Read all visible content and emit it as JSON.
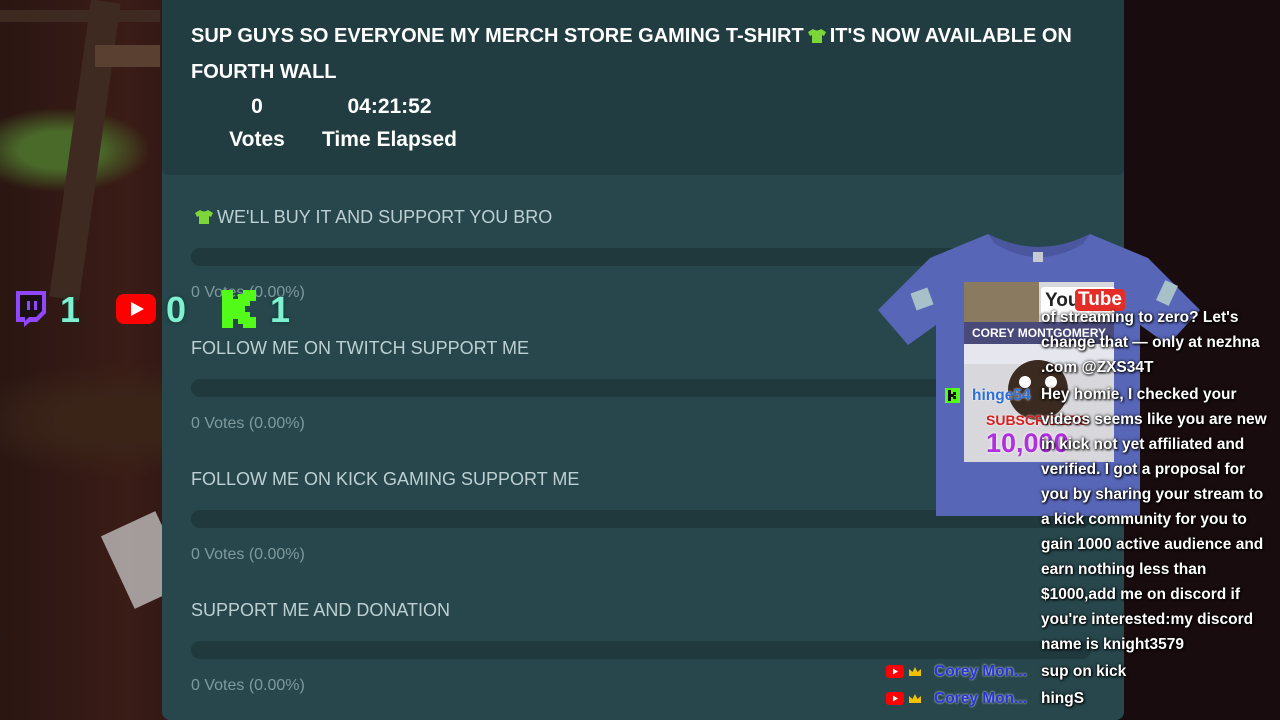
{
  "poll": {
    "title_part1": "SUP GUYS SO EVERYONE MY MERCH STORE GAMING T-SHIRT",
    "title_part2": "IT'S NOW AVAILABLE ON FOURTH WALL",
    "votes_value": "0",
    "votes_label": "Votes",
    "time_value": "04:21:52",
    "time_label": "Time Elapsed",
    "options": [
      {
        "label": "WE'LL BUY IT AND SUPPORT YOU BRO",
        "votes": "0 Votes (0.00%)",
        "fraction": 0
      },
      {
        "label": "FOLLOW ME ON TWITCH SUPPORT ME",
        "votes": "0 Votes (0.00%)",
        "fraction": 0
      },
      {
        "label": "FOLLOW ME ON KICK GAMING SUPPORT ME",
        "votes": "0 Votes (0.00%)",
        "fraction": 0
      },
      {
        "label": "SUPPORT ME AND DONATION",
        "votes": "0 Votes (0.00%)",
        "fraction": 0
      }
    ],
    "colors": {
      "panel": "#27474c",
      "header": "#213d42",
      "shirt_emoji": "#7cd63a"
    }
  },
  "counters": [
    {
      "icon": "twitch-icon",
      "value": "1",
      "color": "#9146ff"
    },
    {
      "icon": "youtube-icon",
      "value": "0",
      "color": "#ff0000"
    },
    {
      "icon": "kick-icon",
      "value": "1",
      "color": "#53fc18"
    }
  ],
  "merch": {
    "youtube_logo_you": "You",
    "youtube_logo_tube": "Tube",
    "banner_text": "COREY MONTGOMERY",
    "subscriber_label": "SUBSCRIBERS",
    "subscriber_count": "10,000"
  },
  "chat": {
    "message_lines": [
      "of streaming to zero? Let's",
      "change that — only at nezhna",
      ".com @ZXS34T",
      "Hey homie, I checked your",
      "videos seems like you are new",
      "in kick not yet affiliated and",
      "verified. I got a proposal for",
      "you by sharing your stream to",
      "a kick community for you to",
      "gain 1000 active audience and",
      "earn nothing less than",
      "$1000,add me on discord if",
      "you're interested:my discord",
      "name is knight3579"
    ],
    "kick_user": "hinge54",
    "messages": [
      {
        "platform": "youtube-icon",
        "badge": "crown-icon",
        "user": "Corey Mon...",
        "text": "sup on kick"
      },
      {
        "platform": "youtube-icon",
        "badge": "crown-icon",
        "user": "Corey Mon...",
        "text": "hingS"
      }
    ]
  }
}
